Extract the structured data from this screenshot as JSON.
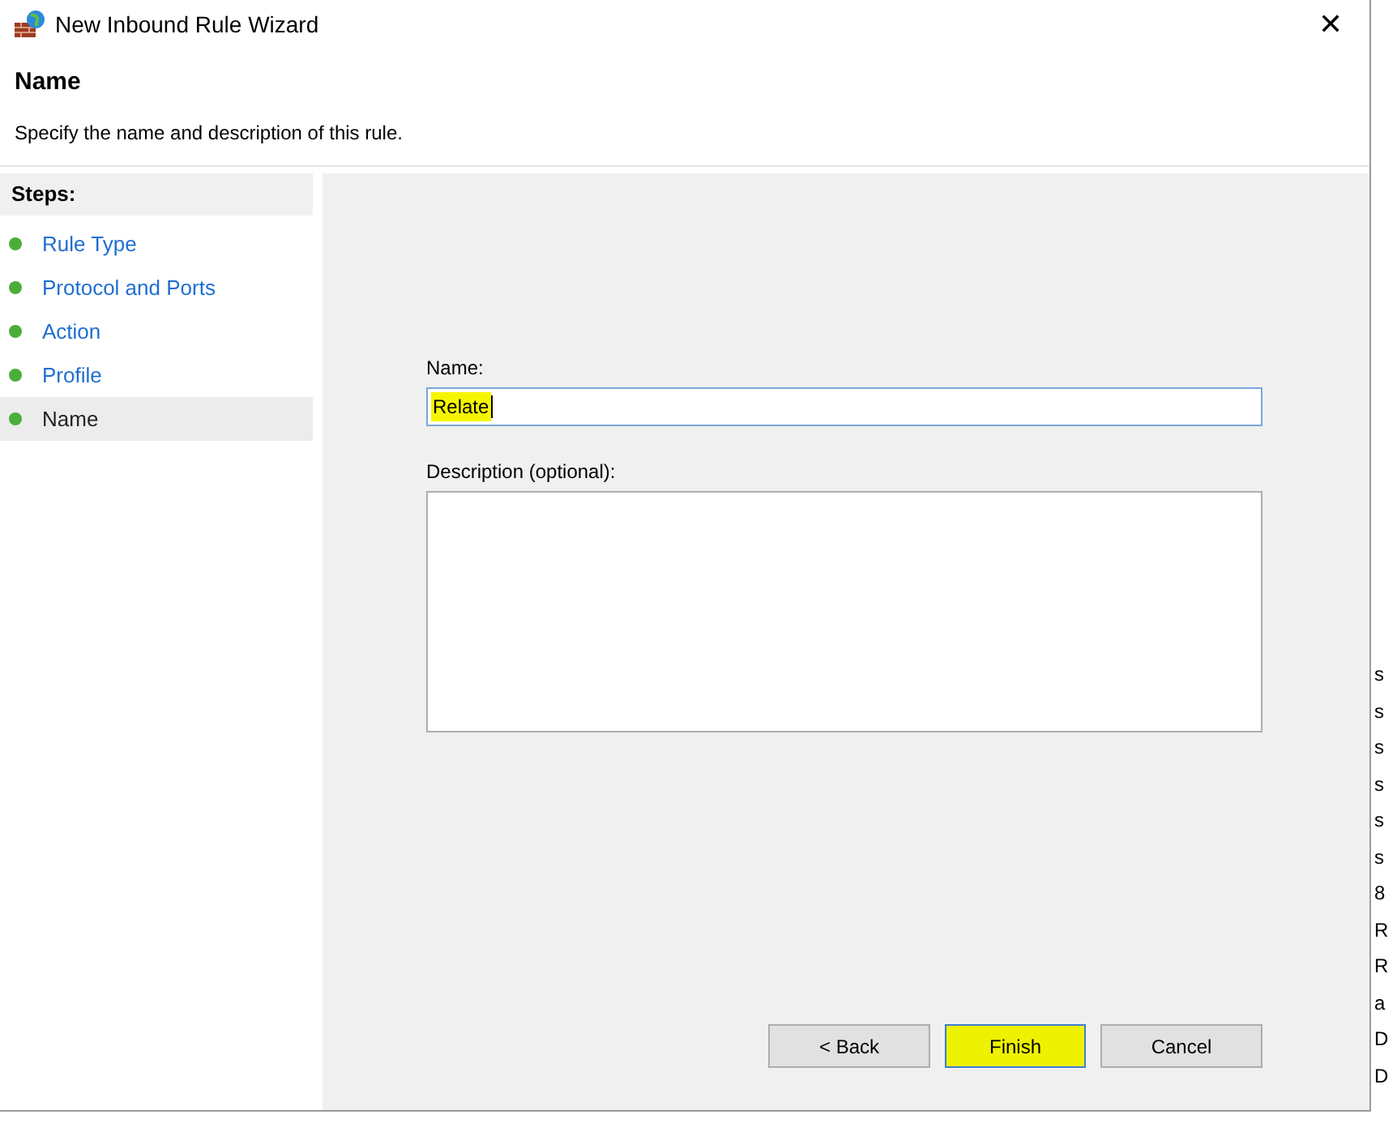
{
  "window": {
    "title": "New Inbound Rule Wizard",
    "close": "✕"
  },
  "header": {
    "title": "Name",
    "subtitle": "Specify the name and description of this rule."
  },
  "steps": {
    "title": "Steps:",
    "items": [
      {
        "label": "Rule Type",
        "selected": false
      },
      {
        "label": "Protocol and Ports",
        "selected": false
      },
      {
        "label": "Action",
        "selected": false
      },
      {
        "label": "Profile",
        "selected": false
      },
      {
        "label": "Name",
        "selected": true
      }
    ]
  },
  "form": {
    "name_label": "Name:",
    "name_value": "Relate",
    "name_highlighted": true,
    "description_label": "Description (optional):"
  },
  "buttons": [
    {
      "label": "< Back",
      "default": false,
      "highlighted": false
    },
    {
      "label": "Finish",
      "default": true,
      "highlighted": true
    },
    {
      "label": "Cancel",
      "default": false,
      "highlighted": false
    }
  ],
  "background_window": {
    "column_1": [
      "s",
      "s",
      "s",
      "s",
      "s",
      "s",
      "8",
      "R",
      "R",
      "a",
      "D",
      "D"
    ]
  }
}
